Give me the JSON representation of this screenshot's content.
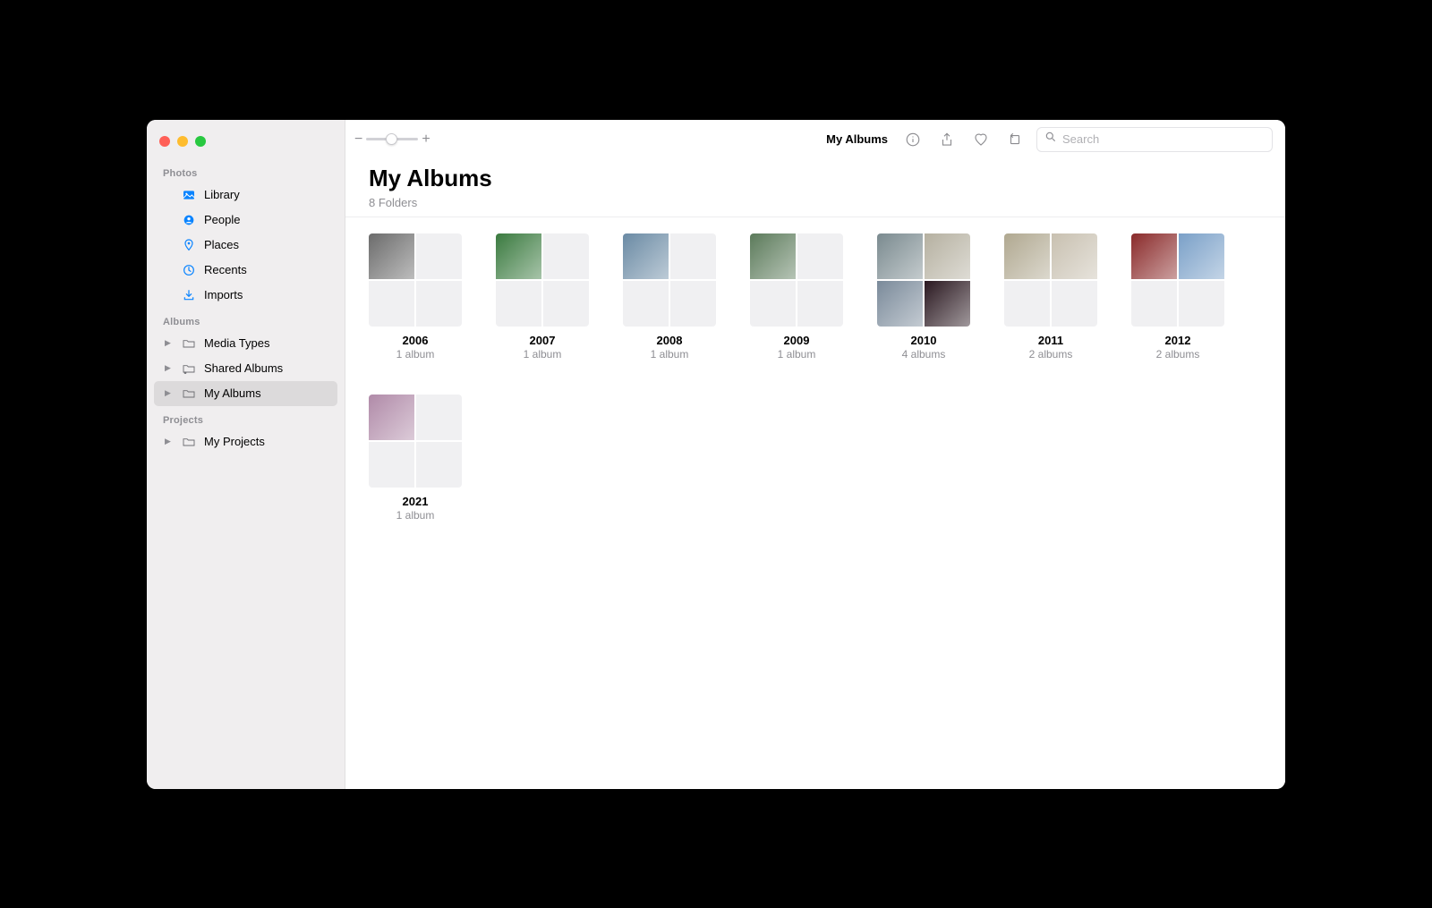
{
  "sidebar": {
    "sections": [
      {
        "header": "Photos",
        "items": [
          {
            "label": "Library",
            "icon": "library-icon",
            "color": "#0a84ff"
          },
          {
            "label": "People",
            "icon": "people-icon",
            "color": "#0a84ff"
          },
          {
            "label": "Places",
            "icon": "places-icon",
            "color": "#0a84ff"
          },
          {
            "label": "Recents",
            "icon": "recents-icon",
            "color": "#0a84ff"
          },
          {
            "label": "Imports",
            "icon": "imports-icon",
            "color": "#0a84ff"
          }
        ]
      },
      {
        "header": "Albums",
        "items": [
          {
            "label": "Media Types",
            "icon": "folder-icon",
            "expandable": true
          },
          {
            "label": "Shared Albums",
            "icon": "shared-folder-icon",
            "expandable": true
          },
          {
            "label": "My Albums",
            "icon": "folder-icon",
            "expandable": true,
            "selected": true
          }
        ]
      },
      {
        "header": "Projects",
        "items": [
          {
            "label": "My Projects",
            "icon": "folder-icon",
            "expandable": true
          }
        ]
      }
    ]
  },
  "toolbar": {
    "zoom_minus": "−",
    "zoom_plus": "+",
    "title": "My Albums",
    "search_placeholder": "Search"
  },
  "page": {
    "title": "My Albums",
    "subtitle": "8 Folders"
  },
  "albums": [
    {
      "name": "2006",
      "count": "1 album",
      "thumbs": 1,
      "colors": [
        "#6b6b6b"
      ]
    },
    {
      "name": "2007",
      "count": "1 album",
      "thumbs": 1,
      "colors": [
        "#3a7a3f"
      ]
    },
    {
      "name": "2008",
      "count": "1 album",
      "thumbs": 1,
      "colors": [
        "#6a8aa4"
      ]
    },
    {
      "name": "2009",
      "count": "1 album",
      "thumbs": 1,
      "colors": [
        "#5b7a5a"
      ]
    },
    {
      "name": "2010",
      "count": "4 albums",
      "thumbs": 4,
      "colors": [
        "#7a8a8f",
        "#b5b0a0",
        "#7a8a9a",
        "#2a1820"
      ]
    },
    {
      "name": "2011",
      "count": "2 albums",
      "thumbs": 2,
      "colors": [
        "#b0a890",
        "#c8c0b0"
      ]
    },
    {
      "name": "2012",
      "count": "2 albums",
      "thumbs": 2,
      "colors": [
        "#8a2a2a",
        "#7aa0c8"
      ]
    },
    {
      "name": "2021",
      "count": "1 album",
      "thumbs": 1,
      "colors": [
        "#b08aa8"
      ]
    }
  ]
}
